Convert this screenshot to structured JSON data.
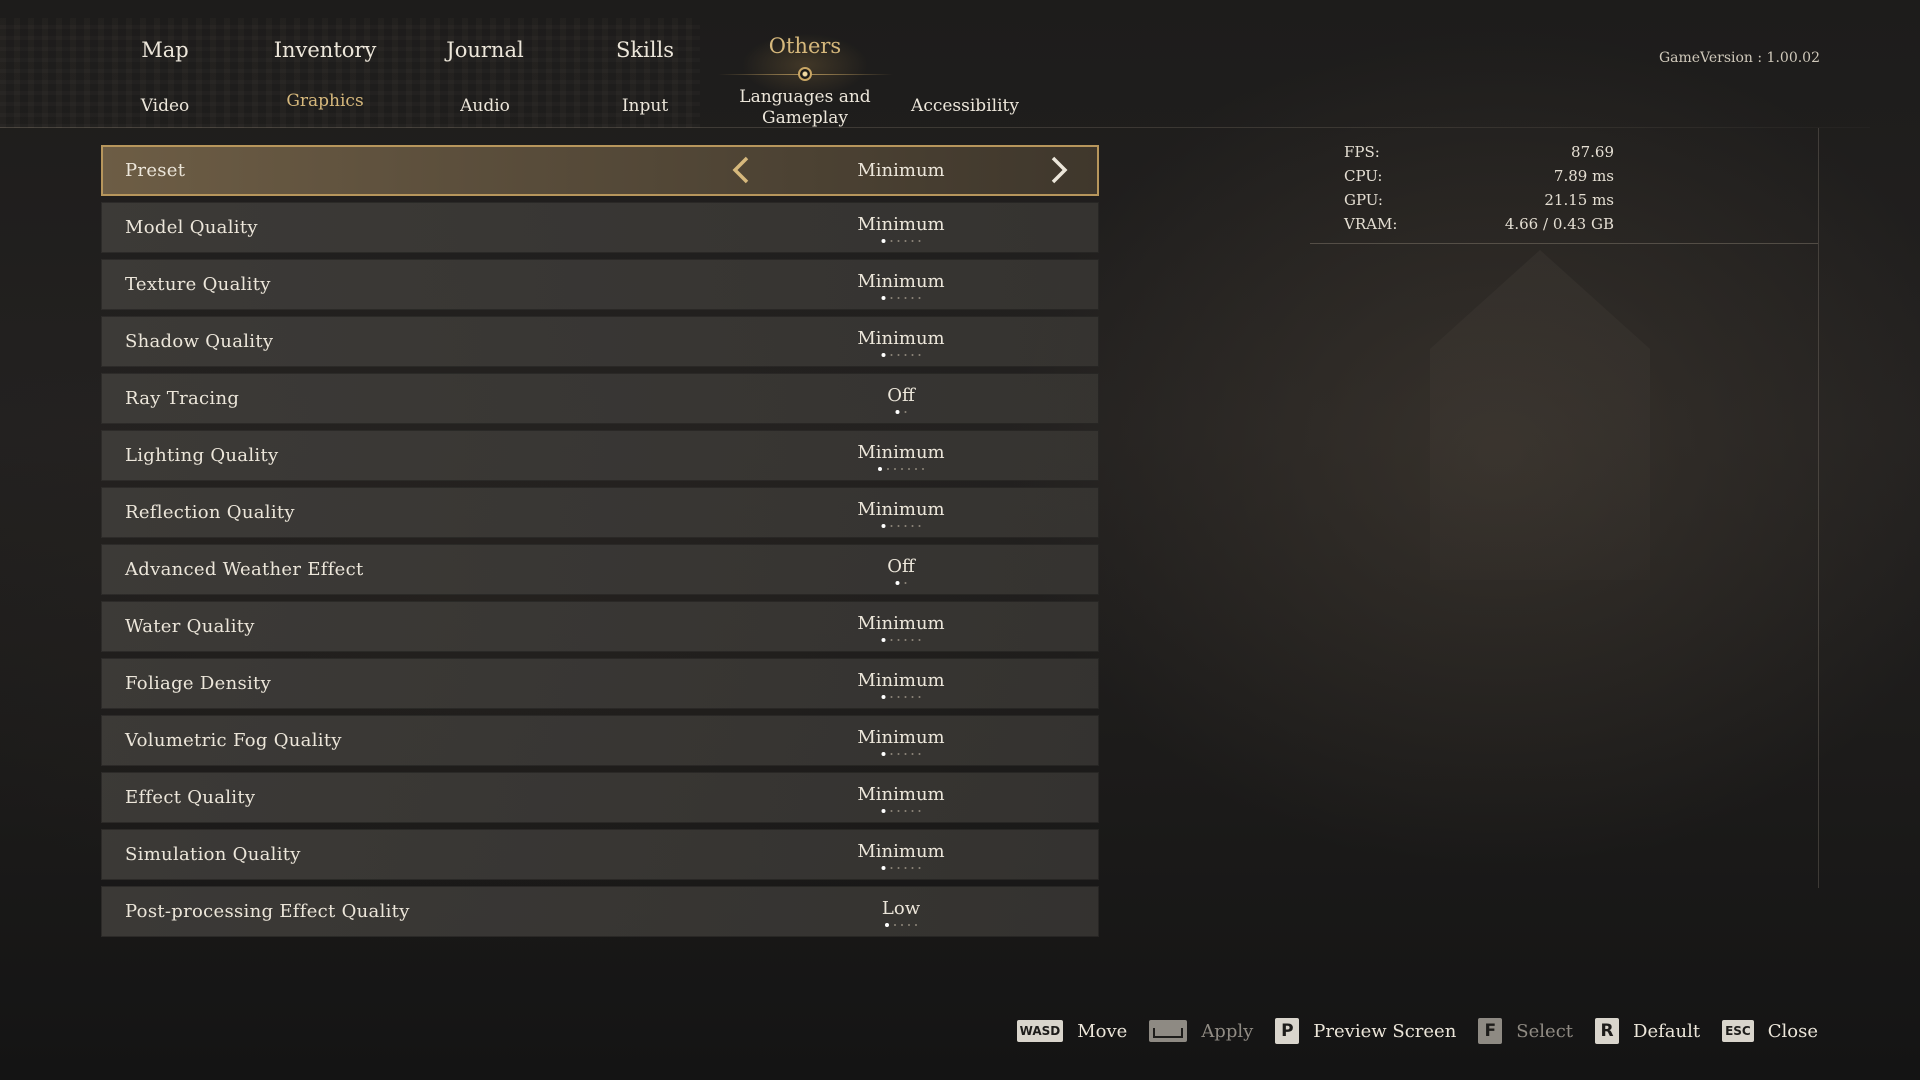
{
  "tabs_main": [
    "Map",
    "Inventory",
    "Journal",
    "Skills",
    "Others"
  ],
  "tabs_sub": [
    "Video",
    "Graphics",
    "Audio",
    "Input",
    "Languages and Gameplay",
    "Accessibility"
  ],
  "sub_two_line": [
    "Languages and",
    "Gameplay"
  ],
  "game_version": "GameVersion : 1.00.02",
  "settings": [
    {
      "label": "Preset",
      "value": "Minimum"
    },
    {
      "label": "Model Quality",
      "value": "Minimum",
      "level": 1,
      "steps": 6
    },
    {
      "label": "Texture Quality",
      "value": "Minimum",
      "level": 1,
      "steps": 6
    },
    {
      "label": "Shadow Quality",
      "value": "Minimum",
      "level": 1,
      "steps": 6
    },
    {
      "label": "Ray Tracing",
      "value": "Off",
      "level": 1,
      "steps": 2
    },
    {
      "label": "Lighting Quality",
      "value": "Minimum",
      "level": 1,
      "steps": 7
    },
    {
      "label": "Reflection Quality",
      "value": "Minimum",
      "level": 1,
      "steps": 6
    },
    {
      "label": "Advanced Weather Effect",
      "value": "Off",
      "level": 1,
      "steps": 2
    },
    {
      "label": "Water Quality",
      "value": "Minimum",
      "level": 1,
      "steps": 6
    },
    {
      "label": "Foliage Density",
      "value": "Minimum",
      "level": 1,
      "steps": 6
    },
    {
      "label": "Volumetric Fog Quality",
      "value": "Minimum",
      "level": 1,
      "steps": 6
    },
    {
      "label": "Effect Quality",
      "value": "Minimum",
      "level": 1,
      "steps": 6
    },
    {
      "label": "Simulation Quality",
      "value": "Minimum",
      "level": 1,
      "steps": 6
    },
    {
      "label": "Post-processing Effect Quality",
      "value": "Low",
      "level": 1,
      "steps": 5
    }
  ],
  "stats": [
    {
      "key": "FPS:",
      "value": "87.69"
    },
    {
      "key": "CPU:",
      "value": "7.89  ms"
    },
    {
      "key": "GPU:",
      "value": "21.15  ms"
    },
    {
      "key": "VRAM:",
      "value": "4.66  /  0.43  GB"
    }
  ],
  "hints": [
    {
      "key": "WASD",
      "label": "Move",
      "enabled": true
    },
    {
      "key": "SPACE",
      "label": "Apply",
      "enabled": false
    },
    {
      "key": "P",
      "label": "Preview Screen",
      "enabled": true
    },
    {
      "key": "F",
      "label": "Select",
      "enabled": false
    },
    {
      "key": "R",
      "label": "Default",
      "enabled": true
    },
    {
      "key": "ESC",
      "label": "Close",
      "enabled": true
    }
  ],
  "colors": {
    "accent": "#d6b87c",
    "selected_border": "#b7965c",
    "text": "#ece6da"
  }
}
